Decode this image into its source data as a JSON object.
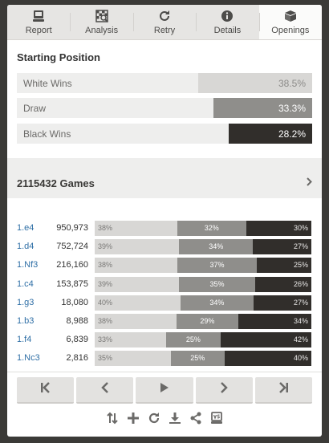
{
  "tabs": [
    {
      "label": "Report",
      "icon": "report-icon"
    },
    {
      "label": "Analysis",
      "icon": "analysis-icon"
    },
    {
      "label": "Retry",
      "icon": "retry-icon"
    },
    {
      "label": "Details",
      "icon": "info-icon"
    },
    {
      "label": "Openings",
      "icon": "openings-book-icon",
      "active": true
    }
  ],
  "starting_position": {
    "title": "Starting Position",
    "white": {
      "label": "White Wins",
      "pct": "38.5%",
      "value": 38.5
    },
    "draw": {
      "label": "Draw",
      "pct": "33.3%",
      "value": 33.3
    },
    "black": {
      "label": "Black Wins",
      "pct": "28.2%",
      "value": 28.2
    }
  },
  "games": {
    "label": "2115432 Games"
  },
  "moves": [
    {
      "move": "1.e4",
      "count": "950,973",
      "w": "38%",
      "d": "32%",
      "b": "30%",
      "wv": 38,
      "dv": 32,
      "bv": 30
    },
    {
      "move": "1.d4",
      "count": "752,724",
      "w": "39%",
      "d": "34%",
      "b": "27%",
      "wv": 39,
      "dv": 34,
      "bv": 27
    },
    {
      "move": "1.Nf3",
      "count": "216,160",
      "w": "38%",
      "d": "37%",
      "b": "25%",
      "wv": 38,
      "dv": 37,
      "bv": 25
    },
    {
      "move": "1.c4",
      "count": "153,875",
      "w": "39%",
      "d": "35%",
      "b": "26%",
      "wv": 39,
      "dv": 35,
      "bv": 26
    },
    {
      "move": "1.g3",
      "count": "18,080",
      "w": "40%",
      "d": "34%",
      "b": "27%",
      "wv": 40,
      "dv": 34,
      "bv": 27
    },
    {
      "move": "1.b3",
      "count": "8,988",
      "w": "38%",
      "d": "29%",
      "b": "34%",
      "wv": 38,
      "dv": 29,
      "bv": 34
    },
    {
      "move": "1.f4",
      "count": "6,839",
      "w": "33%",
      "d": "25%",
      "b": "42%",
      "wv": 33,
      "dv": 25,
      "bv": 42
    },
    {
      "move": "1.Nc3",
      "count": "2,816",
      "w": "35%",
      "d": "25%",
      "b": "40%",
      "wv": 35,
      "dv": 25,
      "bv": 40
    }
  ],
  "nav_buttons": [
    "first-move-icon",
    "previous-move-icon",
    "play-icon",
    "next-move-icon",
    "last-move-icon"
  ],
  "tools": [
    "flip-board-icon",
    "add-icon",
    "reset-icon",
    "download-icon",
    "share-icon",
    "versus-icon"
  ],
  "colors": {
    "white_bar": "#d8d7d5",
    "draw_bar": "#8f8e8b",
    "black_bar": "#312e2b",
    "move_link": "#2f6fa6"
  }
}
